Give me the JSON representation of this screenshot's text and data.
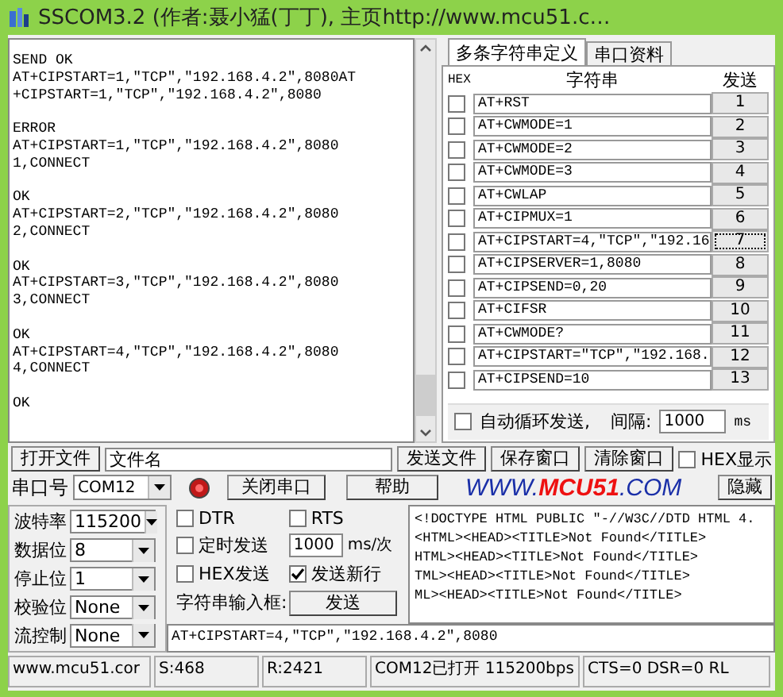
{
  "window": {
    "title": "SSCOM3.2 (作者:聂小猛(丁丁), 主页http://www.mcu51.c…"
  },
  "receive": {
    "blocks": [
      [
        "SEND OK",
        "AT+CIPSTART=1,\"TCP\",\"192.168.4.2\",8080AT",
        "+CIPSTART=1,\"TCP\",\"192.168.4.2\",8080"
      ],
      [
        "ERROR",
        "AT+CIPSTART=1,\"TCP\",\"192.168.4.2\",8080",
        "1,CONNECT"
      ],
      [
        "OK",
        "AT+CIPSTART=2,\"TCP\",\"192.168.4.2\",8080",
        "2,CONNECT"
      ],
      [
        "OK",
        "AT+CIPSTART=3,\"TCP\",\"192.168.4.2\",8080",
        "3,CONNECT"
      ],
      [
        "OK",
        "AT+CIPSTART=4,\"TCP\",\"192.168.4.2\",8080",
        "4,CONNECT"
      ],
      [
        "OK"
      ]
    ]
  },
  "multi": {
    "tabs": [
      {
        "label": "多条字符串定义",
        "selected": true
      },
      {
        "label": "串口资料",
        "selected": false
      }
    ],
    "columns": [
      "HEX",
      "字符串",
      "发送"
    ],
    "rows": [
      {
        "hex": false,
        "text": "AT+RST",
        "send": "1"
      },
      {
        "hex": false,
        "text": "AT+CWMODE=1",
        "send": "2"
      },
      {
        "hex": false,
        "text": "AT+CWMODE=2",
        "send": "3"
      },
      {
        "hex": false,
        "text": "AT+CWMODE=3",
        "send": "4"
      },
      {
        "hex": false,
        "text": "AT+CWLAP",
        "send": "5"
      },
      {
        "hex": false,
        "text": "AT+CIPMUX=1",
        "send": "6"
      },
      {
        "hex": false,
        "text": "AT+CIPSTART=4,\"TCP\",\"192.16",
        "send": "7"
      },
      {
        "hex": false,
        "text": "AT+CIPSERVER=1,8080",
        "send": "8"
      },
      {
        "hex": false,
        "text": "AT+CIPSEND=0,20",
        "send": "9"
      },
      {
        "hex": false,
        "text": "AT+CIFSR",
        "send": "10"
      },
      {
        "hex": false,
        "text": "AT+CWMODE?",
        "send": "11"
      },
      {
        "hex": false,
        "text": "AT+CIPSTART=\"TCP\",\"192.168.",
        "send": "12"
      },
      {
        "hex": false,
        "text": "AT+CIPSEND=10",
        "send": "13"
      }
    ],
    "auto_loop": {
      "label": "自动循环发送,",
      "checked": false,
      "interval_label": "间隔:",
      "interval": "1000",
      "unit": "ms"
    }
  },
  "file_row": {
    "open_file": "打开文件",
    "file_name": "文件名",
    "send_file": "发送文件",
    "save_window": "保存窗口",
    "clear_window": "清除窗口",
    "hex_display": {
      "label": "HEX显示",
      "checked": false
    }
  },
  "port_row": {
    "port_label": "串口号",
    "port": "COM12",
    "open": true,
    "close_port": "关闭串口",
    "help": "帮助",
    "logo": [
      "WWW.",
      "MCU51",
      ".COM"
    ],
    "hide": "隐藏"
  },
  "settings": [
    {
      "label": "波特率",
      "value": "115200"
    },
    {
      "label": "数据位",
      "value": "8"
    },
    {
      "label": "停止位",
      "value": "1"
    },
    {
      "label": "校验位",
      "value": "None"
    },
    {
      "label": "流控制",
      "value": "None"
    }
  ],
  "options": {
    "dtr": {
      "label": "DTR",
      "checked": false
    },
    "rts": {
      "label": "RTS",
      "checked": false
    },
    "timed_send": {
      "label": "定时发送",
      "checked": false
    },
    "interval": "1000",
    "interval_unit": "ms/次",
    "hex_send": {
      "label": "HEX发送",
      "checked": false
    },
    "newline": {
      "label": "发送新行",
      "checked": true
    },
    "input_label": "字符串输入框:",
    "send": "发送",
    "input": "AT+CIPSTART=4,\"TCP\",\"192.168.4.2\",8080"
  },
  "reply_box": [
    "<!DOCTYPE HTML PUBLIC \"-//W3C//DTD HTML 4.",
    "<HTML><HEAD><TITLE>Not Found</TITLE>",
    "HTML><HEAD><TITLE>Not Found</TITLE>",
    "TML><HEAD><TITLE>Not Found</TITLE>",
    "ML><HEAD><TITLE>Not Found</TITLE>"
  ],
  "status_bar": [
    "www.mcu51.cor",
    "S:468",
    "R:2421",
    "COM12已打开  115200bps",
    "CTS=0 DSR=0 RL"
  ]
}
